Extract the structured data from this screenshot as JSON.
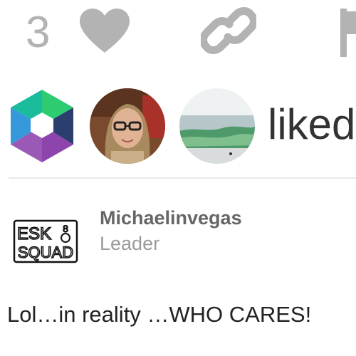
{
  "actions": {
    "like_count": "3",
    "heart_icon": "heart-icon",
    "link_icon": "link-icon",
    "flag_icon": "flag-icon",
    "icon_color": "#b3b3b3"
  },
  "likers": {
    "avatars": [
      "hexagon-logo-avatar",
      "portrait-photo-avatar",
      "ocean-wave-avatar"
    ],
    "liked_label": "liked"
  },
  "post": {
    "avatar_logo_lines": [
      "ESK",
      "SQUAD"
    ],
    "avatar_logo_digits": "8",
    "username": "Michaelinvegas",
    "role": "Leader",
    "body": "Lol…in reality …WHO CARES!"
  }
}
